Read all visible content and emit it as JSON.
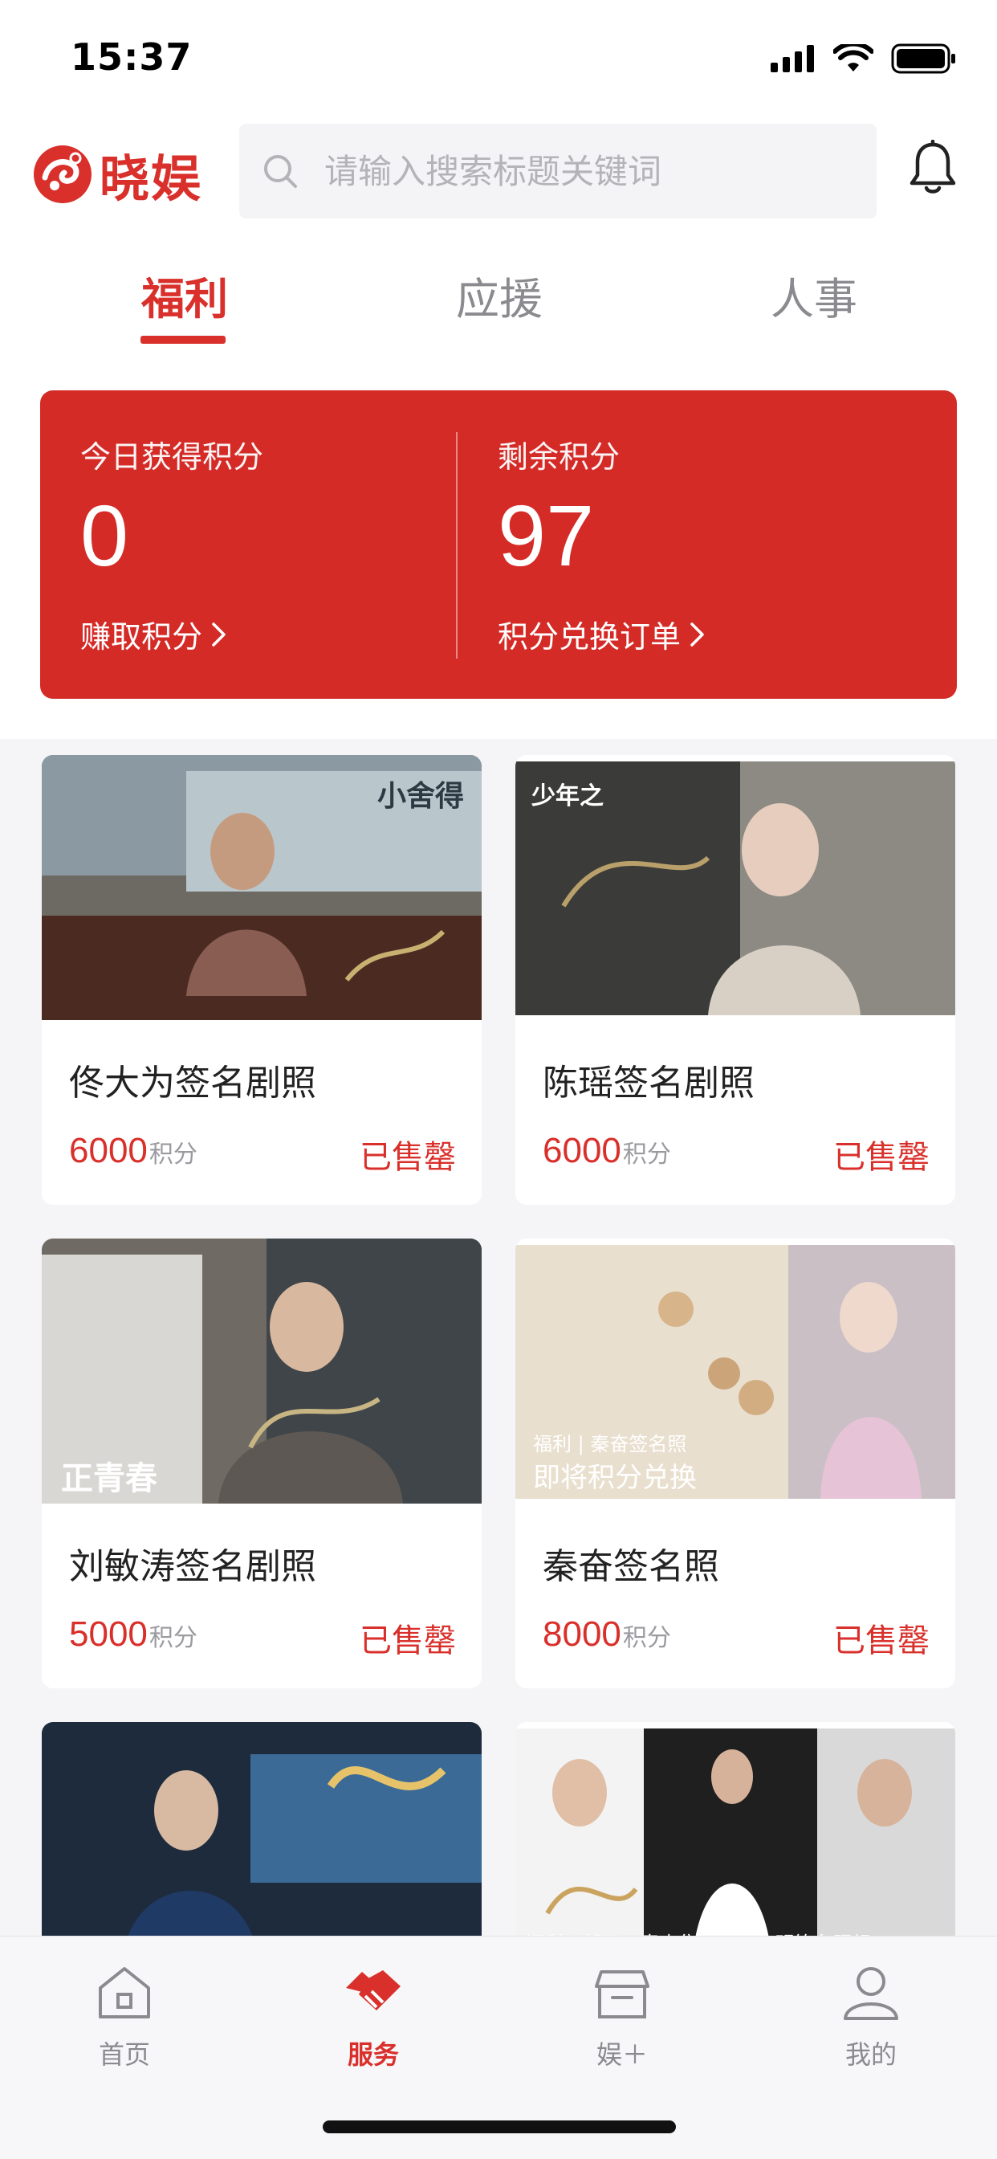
{
  "status_bar": {
    "time": "15:37"
  },
  "header": {
    "logo_text": "晓娱",
    "search_placeholder": "请输入搜索标题关键词"
  },
  "tabs": [
    {
      "label": "福利",
      "active": true
    },
    {
      "label": "应援",
      "active": false
    },
    {
      "label": "人事",
      "active": false
    }
  ],
  "points": {
    "today_label": "今日获得积分",
    "today_value": "0",
    "earn_link": "赚取积分",
    "remaining_label": "剩余积分",
    "remaining_value": "97",
    "orders_link": "积分兑换订单"
  },
  "products": [
    {
      "title": "佟大为签名剧照",
      "points": "6000",
      "unit": "积分",
      "status": "已售罄",
      "image_text": "小舍得"
    },
    {
      "title": "陈瑶签名剧照",
      "points": "6000",
      "unit": "积分",
      "status": "已售罄",
      "image_text": "少年之"
    },
    {
      "title": "刘敏涛签名剧照",
      "points": "5000",
      "unit": "积分",
      "status": "已售罄",
      "image_text": "正青春"
    },
    {
      "title": "秦奋签名照",
      "points": "8000",
      "unit": "积分",
      "status": "已售罄",
      "image_text": "福利 | 秦奋签名照",
      "image_subtext": "即将积分兑换"
    },
    {
      "title": "",
      "points": "",
      "unit": "",
      "status": "",
      "image_text": ""
    },
    {
      "title": "",
      "points": "",
      "unit": "",
      "status": "",
      "image_text": "福利 | 郝云、青克隽逸、郭京明签名照组"
    }
  ],
  "tabbar": [
    {
      "label": "首页",
      "icon": "home-icon",
      "active": false
    },
    {
      "label": "服务",
      "icon": "handshake-icon",
      "active": true
    },
    {
      "label": "娱＋",
      "icon": "store-icon",
      "active": false
    },
    {
      "label": "我的",
      "icon": "user-icon",
      "active": false
    }
  ],
  "colors": {
    "accent": "#d9302b",
    "card_red": "#d42b27",
    "muted": "#8a8a8f",
    "grid_bg": "#f5f5f7"
  }
}
